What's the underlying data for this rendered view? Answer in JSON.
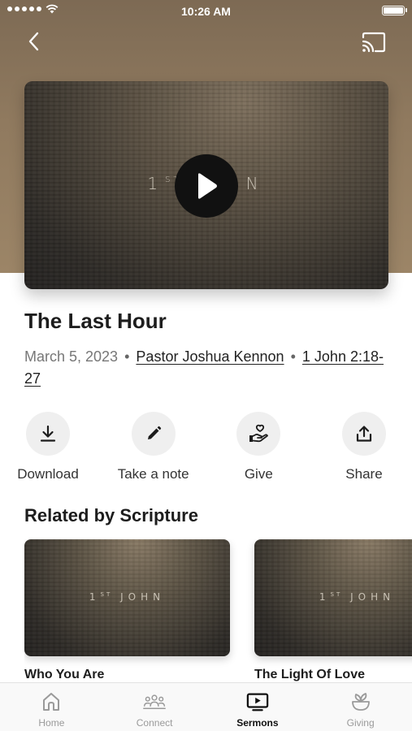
{
  "status_bar": {
    "time": "10:26 AM"
  },
  "video": {
    "title_main": "1",
    "title_sup": "ST",
    "title_rest": "JOHN"
  },
  "sermon": {
    "title": "The Last Hour",
    "date": "March 5, 2023",
    "separator": "•",
    "speaker": "Pastor Joshua Kennon",
    "scripture": "1 John 2:18-27"
  },
  "actions": [
    {
      "label": "Download",
      "icon": "download-icon"
    },
    {
      "label": "Take a note",
      "icon": "pencil-icon"
    },
    {
      "label": "Give",
      "icon": "giving-hand-icon"
    },
    {
      "label": "Share",
      "icon": "share-icon"
    }
  ],
  "related": {
    "heading": "Related by Scripture",
    "items": [
      {
        "title": "Who You Are",
        "thumb_main": "1",
        "thumb_sup": "ST",
        "thumb_rest": "JOHN"
      },
      {
        "title": "The Light Of Love",
        "thumb_main": "1",
        "thumb_sup": "ST",
        "thumb_rest": "JOHN"
      }
    ]
  },
  "tab_bar": {
    "tabs": [
      {
        "label": "Home",
        "icon": "home-icon",
        "active": false
      },
      {
        "label": "Connect",
        "icon": "people-icon",
        "active": false
      },
      {
        "label": "Sermons",
        "icon": "tv-play-icon",
        "active": true
      },
      {
        "label": "Giving",
        "icon": "plant-pot-icon",
        "active": false
      }
    ]
  },
  "colors": {
    "hero_background": "#907a5f",
    "action_circle": "#efefef",
    "tab_active": "#111111",
    "tab_inactive": "#9a9a9a"
  }
}
